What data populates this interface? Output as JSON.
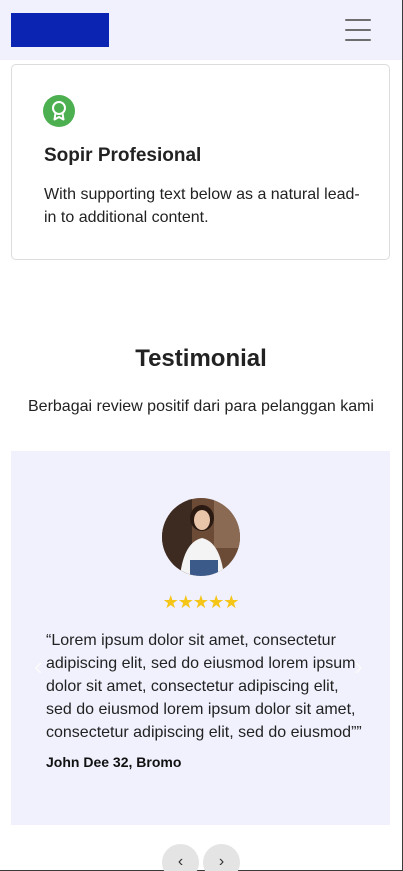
{
  "navbar": {
    "brand_color": "#0b24b2",
    "background": "#f0f1fd",
    "menu_icon": "hamburger-icon"
  },
  "feature": {
    "icon": "award-icon",
    "icon_color": "#4caf50",
    "title": "Sopir Profesional",
    "text": "With supporting text below as a natural lead-in to additional content."
  },
  "testimonial_section": {
    "title": "Testimonial",
    "subtitle": "Berbagai review positif dari para pelanggan kami"
  },
  "testimonial": {
    "avatar": "customer-photo",
    "rating": 5,
    "stars": "★★★★★",
    "quote": "“Lorem ipsum dolor sit amet, consectetur adipiscing elit, sed do eiusmod lorem ipsum dolor sit amet, consectetur adipiscing elit, sed do eiusmod lorem ipsum dolor sit amet, consectetur adipiscing elit, sed do eiusmod””",
    "author": "John Dee 32, Bromo",
    "background": "#f0f1fd"
  },
  "carousel": {
    "prev_icon": "chevron-left-icon",
    "next_icon": "chevron-right-icon",
    "prev_label": "‹",
    "next_label": "›"
  }
}
